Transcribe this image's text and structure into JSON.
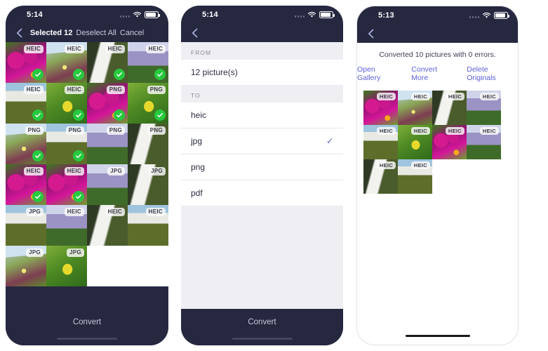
{
  "screen1": {
    "status": {
      "time": "5:14",
      "wifi_icon": "wifi-icon",
      "battery_icon": "battery-icon",
      "signal_icon": "signal-dots-icon"
    },
    "nav": {
      "back_icon": "chevron-left-icon",
      "selected_label": "Selected 12",
      "deselect_label": "Deselect All",
      "cancel_label": "Cancel"
    },
    "bottom": {
      "convert_label": "Convert"
    },
    "photos": [
      {
        "badge": "HEIC",
        "selected": true,
        "img": "flowers-pink"
      },
      {
        "badge": "HEIC",
        "selected": true,
        "img": "field-slope"
      },
      {
        "badge": "HEIC",
        "selected": true,
        "img": "waterfall-moss"
      },
      {
        "badge": "HEIC",
        "selected": true,
        "img": "canyon-falls"
      },
      {
        "badge": "HEIC",
        "selected": true,
        "img": "cliff-falls"
      },
      {
        "badge": "HEIC",
        "selected": true,
        "img": "green-leaves"
      },
      {
        "badge": "PNG",
        "selected": true,
        "img": "flowers-pink"
      },
      {
        "badge": "PNG",
        "selected": true,
        "img": "green-leaves"
      },
      {
        "badge": "PNG",
        "selected": true,
        "img": "field-slope"
      },
      {
        "badge": "PNG",
        "selected": true,
        "img": "cliff-falls"
      },
      {
        "badge": "PNG",
        "selected": false,
        "img": "canyon-falls"
      },
      {
        "badge": "PNG",
        "selected": false,
        "img": "waterfall-moss"
      },
      {
        "badge": "HEIC",
        "selected": true,
        "img": "flowers-pink"
      },
      {
        "badge": "HEIC",
        "selected": true,
        "img": "flowers-pink"
      },
      {
        "badge": "JPG",
        "selected": false,
        "img": "canyon-falls"
      },
      {
        "badge": "JPG",
        "selected": false,
        "img": "waterfall-moss"
      },
      {
        "badge": "JPG",
        "selected": false,
        "img": "cliff-falls"
      },
      {
        "badge": "HEIC",
        "selected": false,
        "img": "canyon-falls"
      },
      {
        "badge": "HEIC",
        "selected": false,
        "img": "waterfall-moss"
      },
      {
        "badge": "HEIC",
        "selected": false,
        "img": "cliff-falls"
      },
      {
        "badge": "JPG",
        "selected": false,
        "img": "field-slope"
      },
      {
        "badge": "JPG",
        "selected": false,
        "img": "green-leaves"
      }
    ]
  },
  "screen2": {
    "status": {
      "time": "5:14",
      "wifi_icon": "wifi-icon",
      "battery_icon": "battery-icon",
      "signal_icon": "signal-dots-icon"
    },
    "nav": {
      "back_icon": "chevron-left-icon"
    },
    "from": {
      "header": "FROM",
      "value": "12 picture(s)"
    },
    "to": {
      "header": "TO",
      "options": [
        {
          "label": "heic",
          "selected": false
        },
        {
          "label": "jpg",
          "selected": true
        },
        {
          "label": "png",
          "selected": false
        },
        {
          "label": "pdf",
          "selected": false
        }
      ],
      "check_glyph": "✓"
    },
    "bottom": {
      "convert_label": "Convert"
    }
  },
  "screen3": {
    "status": {
      "time": "5:13",
      "wifi_icon": "wifi-icon",
      "battery_icon": "battery-icon",
      "signal_icon": "signal-dots-icon"
    },
    "nav": {
      "back_icon": "chevron-left-icon"
    },
    "result": {
      "message": "Converted 10 pictures with 0 errors."
    },
    "actions": [
      {
        "label": "Open Gallery"
      },
      {
        "label": "Convert More"
      },
      {
        "label": "Delete Originals"
      }
    ],
    "photos": [
      {
        "badge": "HEIC",
        "img": "flowers-pink"
      },
      {
        "badge": "HEIC",
        "img": "field-slope"
      },
      {
        "badge": "HEIC",
        "img": "waterfall-moss"
      },
      {
        "badge": "HEIC",
        "img": "canyon-falls"
      },
      {
        "badge": "HEIC",
        "img": "cliff-falls"
      },
      {
        "badge": "HEIC",
        "img": "green-leaves"
      },
      {
        "badge": "HEIC",
        "img": "flowers-pink"
      },
      {
        "badge": "HEIC",
        "img": "canyon-falls"
      },
      {
        "badge": "HEIC",
        "img": "waterfall-moss"
      },
      {
        "badge": "HEIC",
        "img": "cliff-falls"
      }
    ]
  },
  "colors": {
    "dark_chrome": "#262840",
    "accent_link": "#5b5fd6",
    "check_green": "#27c93f",
    "list_bg": "#eeeef3"
  }
}
